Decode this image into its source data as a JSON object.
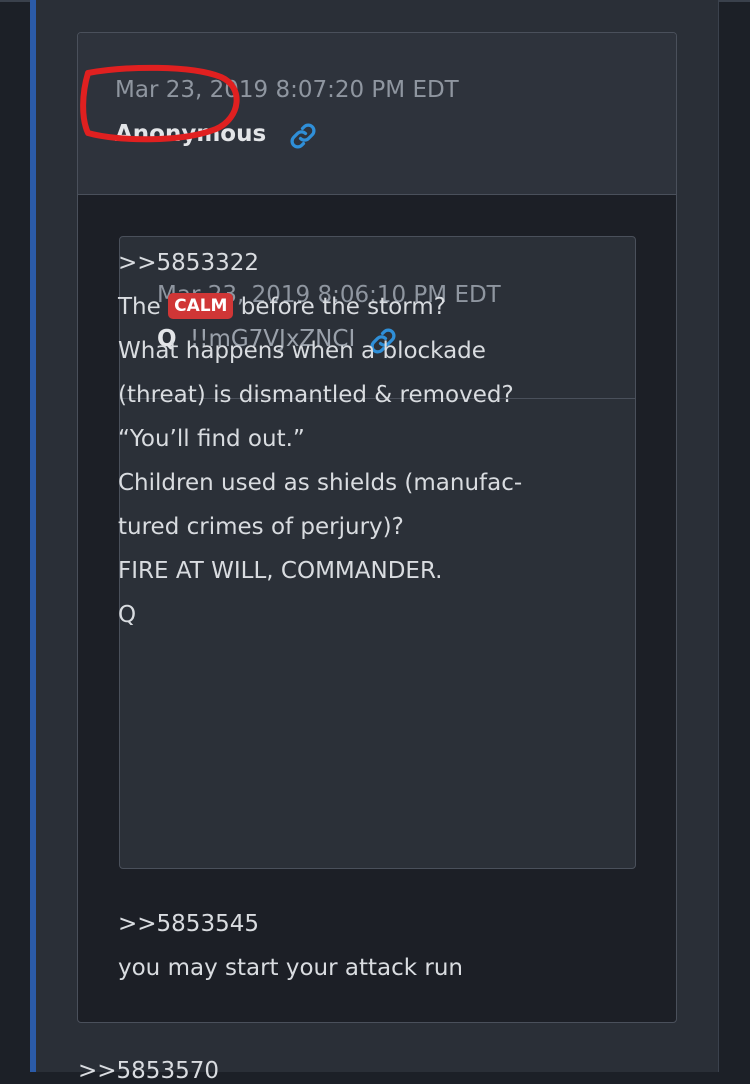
{
  "post": {
    "timestamp": "Mar 23, 2019 8:07:20 PM EDT",
    "author": "Anonymous",
    "quoted": {
      "timestamp": "Mar 23, 2019 8:06:10 PM EDT",
      "name": "Q",
      "tripcode": "!!mG7VJxZNCI",
      "lines": [
        ">>5853322",
        "The",
        "CALM",
        "before the storm?",
        "What happens when a blockade",
        "(threat) is dismantled & removed?",
        "“You’ll find out.”",
        "Children used as shields (manufac-",
        "tured crimes of perjury)?",
        "FIRE AT WILL, COMMANDER.",
        "Q"
      ]
    },
    "reply_lines": [
      ">>5853545",
      "you may start your attack run"
    ]
  },
  "next_post_ref": ">>5853570",
  "colors": {
    "accent_blue": "#2b5ba8",
    "link_icon": "#2f8fd8",
    "badge_red": "#d03636",
    "annotation_red": "#e02020"
  },
  "icons": [
    "link-icon",
    "link-icon"
  ]
}
